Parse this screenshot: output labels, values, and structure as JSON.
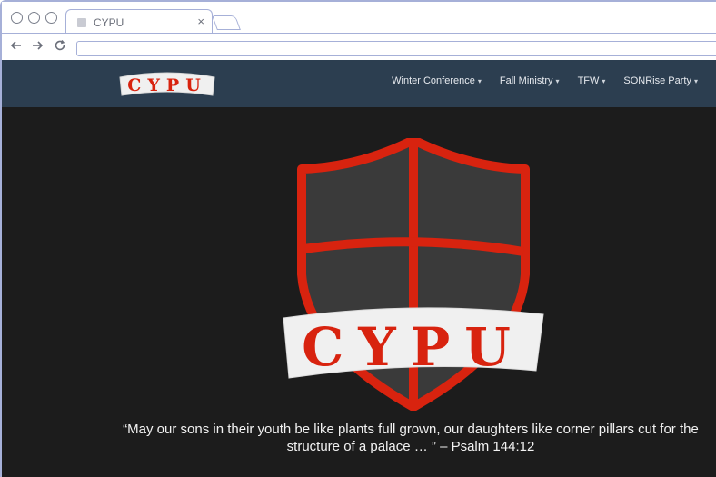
{
  "browser": {
    "tab_title": "CYPU",
    "tab_close": "×",
    "back_icon": "arrow-left-icon",
    "forward_icon": "arrow-right-icon",
    "reload_icon": "reload-icon",
    "address": ""
  },
  "site": {
    "brand": "CYPU",
    "nav": [
      {
        "label": "Winter Conference"
      },
      {
        "label": "Fall Ministry"
      },
      {
        "label": "TFW"
      },
      {
        "label": "SONRise Party"
      }
    ],
    "hero_logo_text": "CYPU",
    "quote": "“May our sons in their youth be like plants full grown, our daughters like corner pillars cut for the structure of a palace … ” – Psalm 144:12"
  },
  "colors": {
    "navbar": "#2c3e50",
    "hero_bg": "#1c1c1c",
    "shield_red": "#d8230f",
    "shield_dark": "#3a3a3a",
    "banner": "#f0f0f0"
  }
}
